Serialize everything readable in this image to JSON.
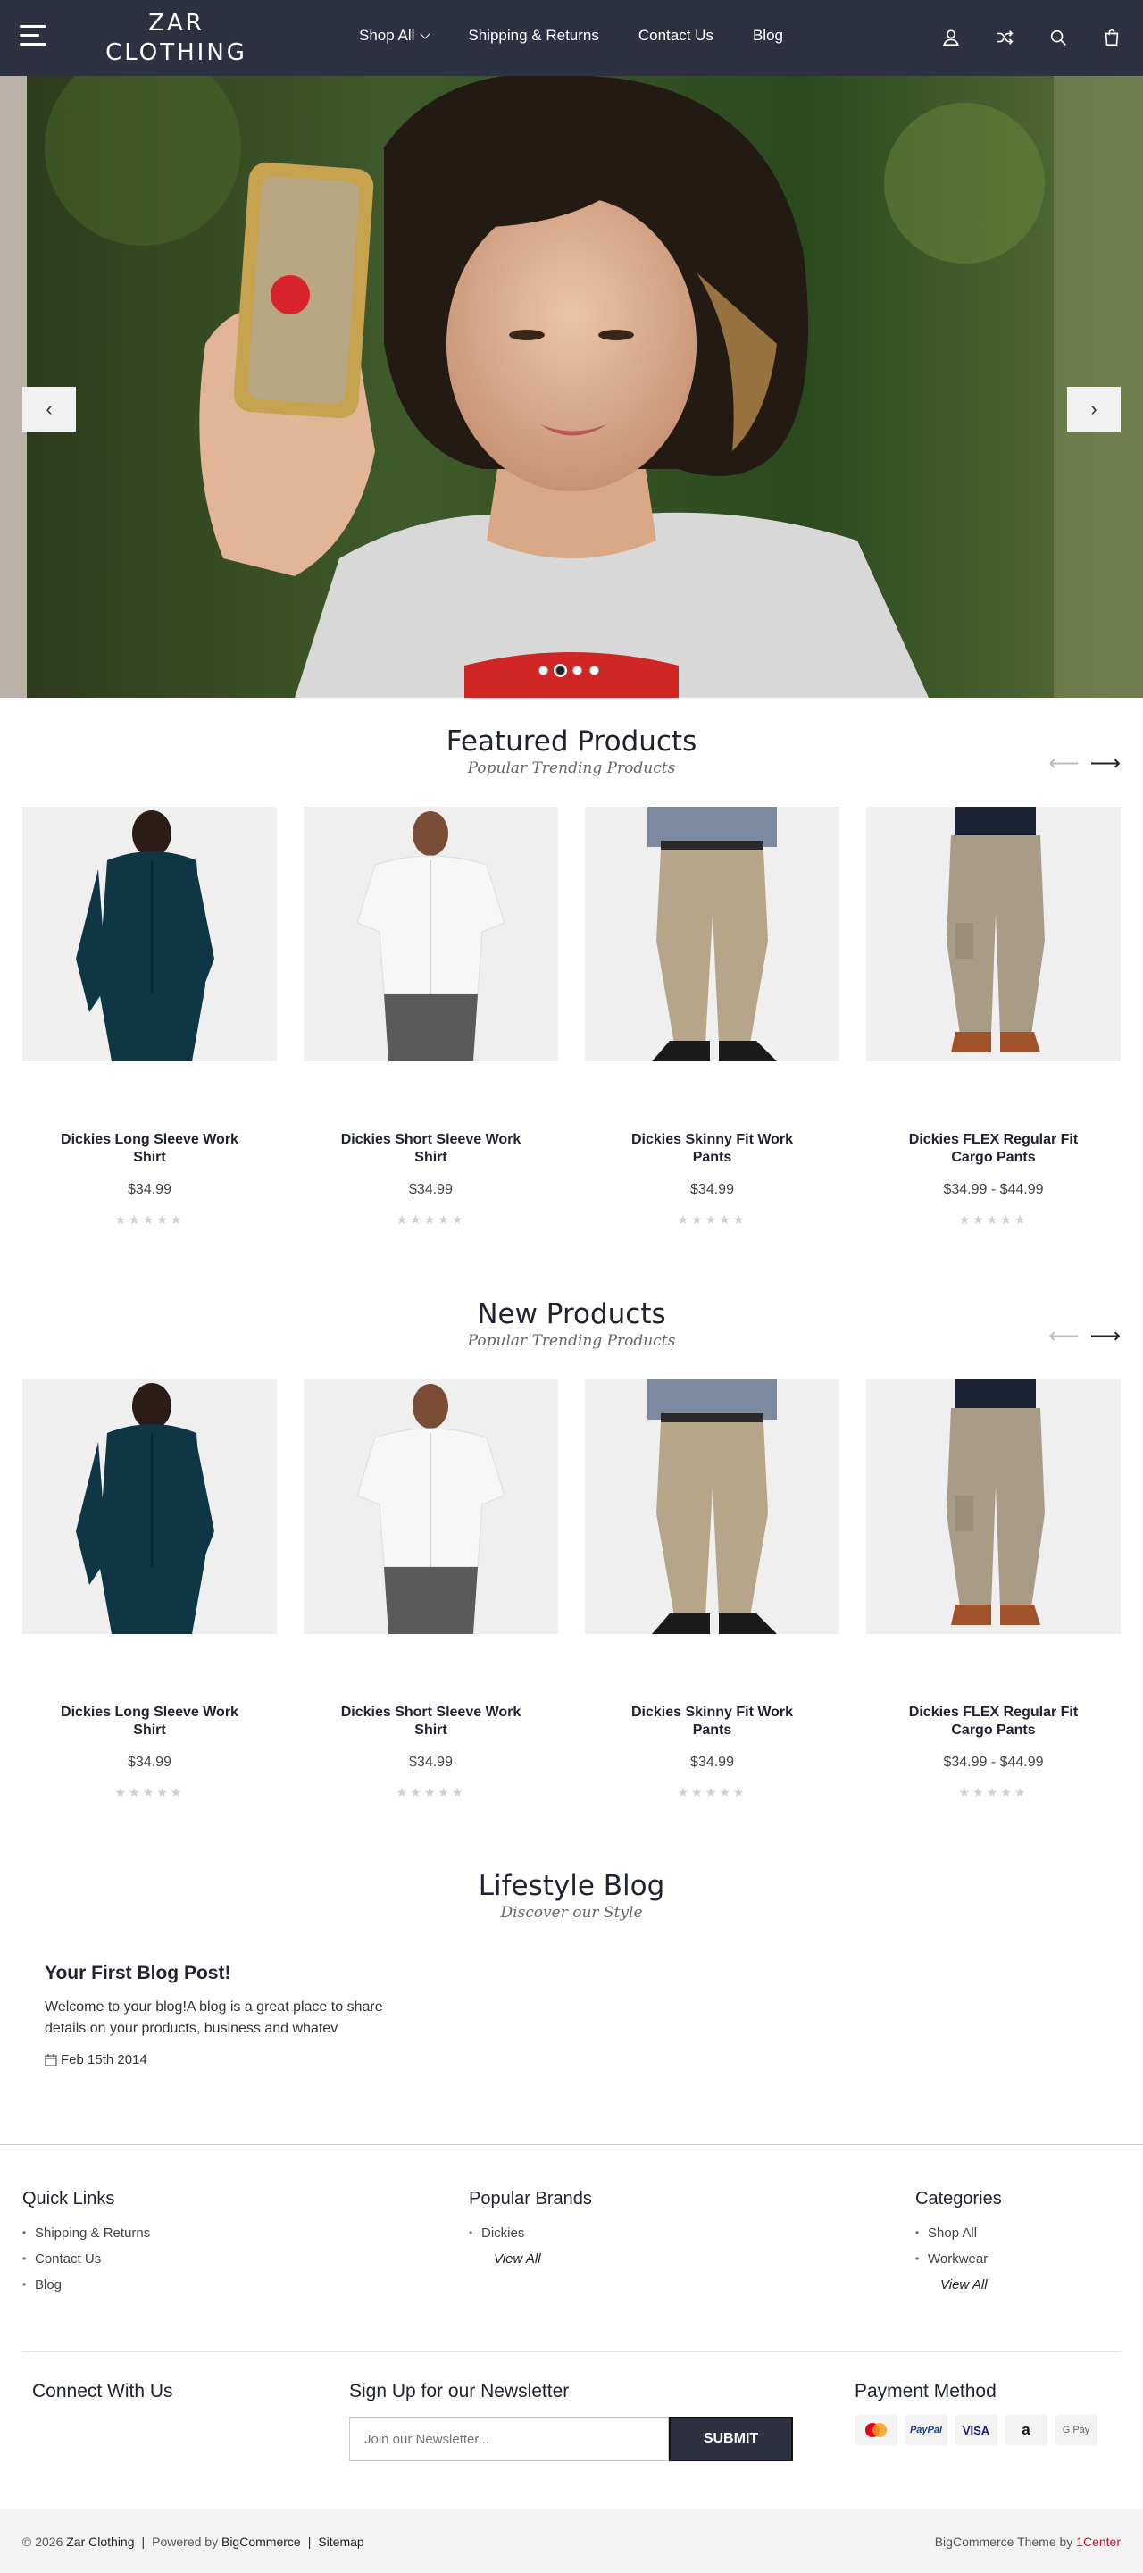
{
  "header": {
    "logo": "ZAR\nCLOTHING",
    "nav": [
      {
        "label": "Shop All",
        "dropdown": true
      },
      {
        "label": "Shipping & Returns"
      },
      {
        "label": "Contact Us"
      },
      {
        "label": "Blog"
      }
    ],
    "icons": [
      "user-icon",
      "shuffle-icon",
      "search-icon",
      "bag-icon"
    ]
  },
  "hero": {
    "prev_label": "‹",
    "next_label": "›",
    "dots": 4,
    "active_dot": 2
  },
  "featured": {
    "title": "Featured Products",
    "subtitle": "Popular Trending Products",
    "products": [
      {
        "name": "Dickies Long Sleeve Work Shirt",
        "price": "$34.99",
        "stars": "★★★★★"
      },
      {
        "name": "Dickies Short Sleeve Work Shirt",
        "price": "$34.99",
        "stars": "★★★★★"
      },
      {
        "name": "Dickies Skinny Fit Work Pants",
        "price": "$34.99",
        "stars": "★★★★★"
      },
      {
        "name": "Dickies FLEX Regular Fit Cargo Pants",
        "price": "$34.99 - $44.99",
        "stars": "★★★★★"
      }
    ]
  },
  "new_products": {
    "title": "New Products",
    "subtitle": "Popular Trending Products",
    "products": [
      {
        "name": "Dickies Long Sleeve Work Shirt",
        "price": "$34.99",
        "stars": "★★★★★"
      },
      {
        "name": "Dickies Short Sleeve Work Shirt",
        "price": "$34.99",
        "stars": "★★★★★"
      },
      {
        "name": "Dickies Skinny Fit Work Pants",
        "price": "$34.99",
        "stars": "★★★★★"
      },
      {
        "name": "Dickies FLEX Regular Fit Cargo Pants",
        "price": "$34.99 - $44.99",
        "stars": "★★★★★"
      }
    ]
  },
  "blog": {
    "title": "Lifestyle Blog",
    "subtitle": "Discover our Style",
    "post": {
      "title": "Your First Blog Post!",
      "excerpt": "Welcome to your blog!A blog is a great place to share details on your products, business and whatev",
      "date": "Feb 15th 2014"
    }
  },
  "footer": {
    "quick_links": {
      "title": "Quick Links",
      "items": [
        "Shipping & Returns",
        "Contact Us",
        "Blog"
      ]
    },
    "brands": {
      "title": "Popular Brands",
      "items": [
        "Dickies"
      ],
      "view_all": "View All"
    },
    "categories": {
      "title": "Categories",
      "items": [
        "Shop All",
        "Workwear"
      ],
      "view_all": "View All"
    },
    "connect_title": "Connect With Us",
    "newsletter_title": "Sign Up for our Newsletter",
    "newsletter_placeholder": "Join our Newsletter...",
    "newsletter_button": "SUBMIT",
    "payment_title": "Payment Method",
    "payments": [
      "Mastercard",
      "PayPal",
      "VISA",
      "a",
      "G Pay"
    ],
    "copyright": "© 2026",
    "store_name": "Zar Clothing",
    "powered_by": "Powered by",
    "platform": "BigCommerce",
    "sitemap": "Sitemap",
    "theme_text": "BigCommerce Theme by",
    "theme_author": "1Center"
  },
  "colors": {
    "header_bg": "#2d3142",
    "accent_red": "#c8102e"
  }
}
